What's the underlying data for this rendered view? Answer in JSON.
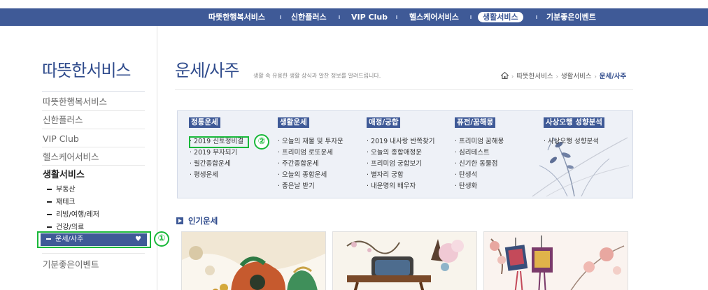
{
  "topnav": {
    "items": [
      "따뜻한행복서비스",
      "신한플러스",
      "VIP Club",
      "헬스케어서비스",
      "생활서비스",
      "기분좋은이벤트"
    ],
    "active_index": 4
  },
  "sidebar": {
    "title": "따뜻한서비스",
    "items": [
      "따뜻한행복서비스",
      "신한플러스",
      "VIP Club",
      "헬스케어서비스"
    ],
    "current_label": "생활서비스",
    "sub_items": [
      "부동산",
      "재테크",
      "리빙/여행/레저",
      "건강/의료"
    ],
    "active_sub": "운세/사주",
    "heart_icon": "heart-icon",
    "last_item": "기분좋은이벤트"
  },
  "annotations": {
    "marker1": "①",
    "marker2": "②",
    "color": "#19b83a"
  },
  "main": {
    "title": "운세/사주",
    "description": "생활 속 유용한 생활 상식과 알찬 정보를 알려드립니다.",
    "breadcrumb": {
      "home_icon": "home-icon",
      "items": [
        "따뜻한서비스",
        "생활서비스"
      ],
      "current": "운세/사주"
    },
    "menu": [
      {
        "head": "정통운세",
        "items": [
          "2019 신토정비결",
          "2019 부자되기",
          "월간종합운세",
          "평생운세"
        ]
      },
      {
        "head": "생활운세",
        "items": [
          "오늘의 재물 및 투자운",
          "프리미엄 로또운세",
          "주간종합운세",
          "오늘의 종합운세",
          "좋은날 받기"
        ]
      },
      {
        "head": "애정/궁합",
        "items": [
          "2019 내사랑 반쪽찾기",
          "오늘의 종합애정운",
          "프리미엄 궁합보기",
          "별자리 궁합",
          "내운명의 배우자"
        ]
      },
      {
        "head": "퓨전/꿈해몽",
        "items": [
          "프리미엄 꿈해몽",
          "심리테스트",
          "신기한 동물점",
          "탄생석",
          "탄생화"
        ]
      },
      {
        "head": "사상오행 성향분석",
        "items": [
          "사상오행 성향분석"
        ]
      }
    ],
    "popular_title": "인기운세"
  },
  "colors": {
    "brand": "#3f5a97",
    "title": "#2f4b8c",
    "highlight": "#19b83a"
  }
}
